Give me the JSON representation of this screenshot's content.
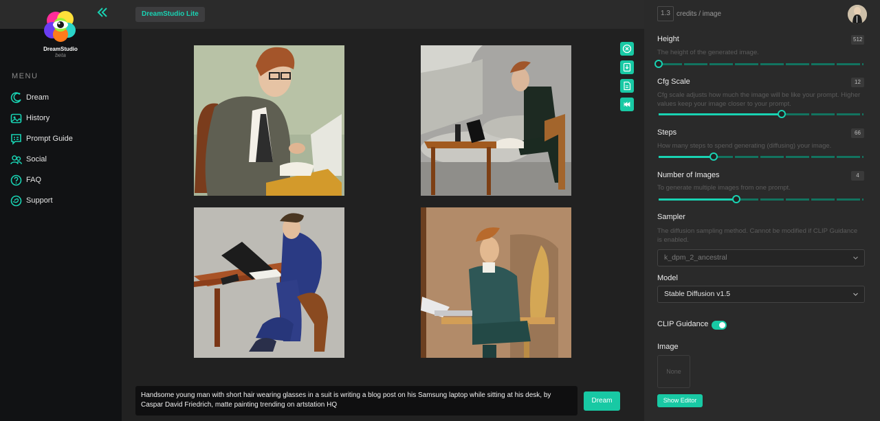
{
  "sidebar": {
    "logo_name": "DreamStudio",
    "logo_sub": "beta",
    "menu_title": "MENU",
    "items": [
      {
        "label": "Dream",
        "icon": "dream-icon"
      },
      {
        "label": "History",
        "icon": "history-icon"
      },
      {
        "label": "Prompt Guide",
        "icon": "prompt-guide-icon"
      },
      {
        "label": "Social",
        "icon": "social-icon"
      },
      {
        "label": "FAQ",
        "icon": "faq-icon"
      },
      {
        "label": "Support",
        "icon": "support-icon"
      }
    ]
  },
  "header": {
    "badge": "DreamStudio Lite"
  },
  "credits": {
    "value": "1.3",
    "label": "credits / image"
  },
  "params": {
    "height": {
      "label": "Height",
      "value": "512",
      "desc": "The height of the generated image.",
      "level": 0.0
    },
    "cfg": {
      "label": "Cfg Scale",
      "value": "12",
      "desc": "Cfg scale adjusts how much the image will be like your prompt. Higher values keep your image closer to your prompt.",
      "level": 0.6
    },
    "steps": {
      "label": "Steps",
      "value": "66",
      "desc": "How many steps to spend generating (diffusing) your image.",
      "level": 0.27
    },
    "num_images": {
      "label": "Number of Images",
      "value": "4",
      "desc": "To generate multiple images from one prompt.",
      "level": 0.38
    },
    "sampler": {
      "label": "Sampler",
      "desc": "The diffusion sampling method. Cannot be modified if CLIP Guidance is enabled.",
      "selected": "k_dpm_2_ancestral"
    },
    "model": {
      "label": "Model",
      "selected": "Stable Diffusion v1.5"
    },
    "clip": {
      "label": "CLIP Guidance",
      "enabled": true
    },
    "image": {
      "label": "Image",
      "placeholder": "None",
      "editor_button": "Show Editor"
    }
  },
  "prompt": {
    "text": "Handsome young man with short hair wearing glasses in a suit is writing a blog post on his Samsung laptop while sitting at his desk, by Caspar David Friedrich, matte painting trending on artstation HQ",
    "button": "Dream"
  },
  "colors": {
    "accent": "#19d3b3",
    "sidebar_bg": "#111214",
    "panel_bg": "#2a2a2a",
    "gallery_bg": "#212121"
  }
}
